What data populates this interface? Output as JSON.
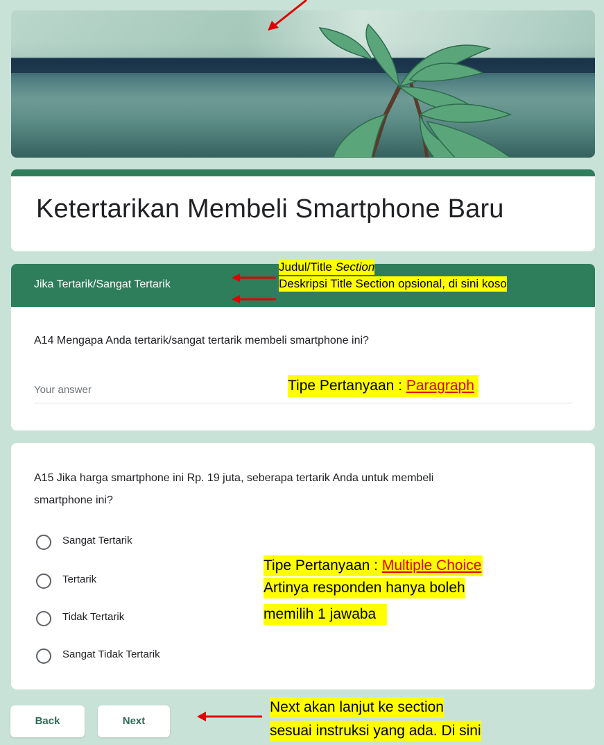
{
  "form": {
    "title": "Ketertarikan Membeli Smartphone Baru",
    "section_title": "Jika Tertarik/Sangat Tertarik",
    "q14": {
      "text": "A14 Mengapa Anda tertarik/sangat tertarik membeli smartphone ini?",
      "placeholder": "Your answer"
    },
    "q15": {
      "text_line1": "A15 Jika harga smartphone ini Rp. 19 juta, seberapa tertarik Anda untuk membeli",
      "text_line2": "smartphone ini?",
      "options": [
        "Sangat Tertarik",
        "Tertarik",
        "Tidak Tertarik",
        "Sangat Tidak Tertarik"
      ]
    },
    "buttons": {
      "back": "Back",
      "next": "Next"
    }
  },
  "annotations": {
    "section_title_label_prefix": "Judul/Title ",
    "section_title_label_italic": "Section",
    "section_desc_label": "Deskripsi Title Section opsional, di sini koso",
    "paragraph_prefix": "Tipe Pertanyaan : ",
    "paragraph_link": "Paragraph",
    "mc_prefix": "Tipe Pertanyaan : ",
    "mc_link": "Multiple Choice",
    "mc_line2": "Artinya responden hanya boleh",
    "mc_line3": "memilih 1 jawaba",
    "next_line1": "Next akan lanjut ke section",
    "next_line2": "sesuai instruksi yang ada. Di sini"
  },
  "colors": {
    "theme": "#2e7d5b",
    "background": "#c9e2d7",
    "highlight": "#ffff00",
    "arrow": "#e00000"
  }
}
